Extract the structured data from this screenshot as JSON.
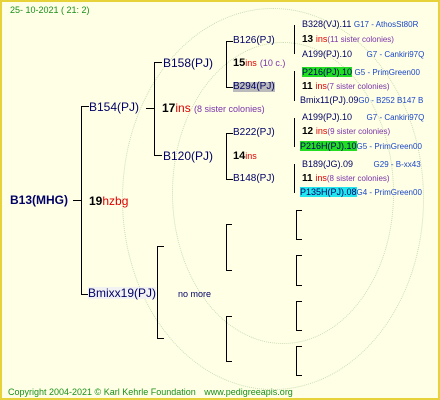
{
  "header": {
    "date": "25- 10-2021 ( 21: 2)"
  },
  "footer": {
    "copyright": "Copyright 2004-2021 © Karl Kehrle Foundation",
    "url": "www.pedigreeapis.org"
  },
  "root": {
    "name": "B13(MHG)",
    "num": "19",
    "ins": "hzbg"
  },
  "gen1": {
    "top": {
      "name": "B154(PJ)",
      "num": "17",
      "ins": "ins",
      "note": "(8 sister colonies)"
    },
    "bottom": {
      "name": "Bmixx19(PJ)",
      "note": "no more"
    }
  },
  "gen2": {
    "a": {
      "name": "B158(PJ)",
      "num": "15",
      "ins": "ins",
      "note": "(10 c.)"
    },
    "b": {
      "name": "B120(PJ)",
      "num": "14",
      "ins": "ins"
    }
  },
  "gen3": {
    "a": {
      "name": "B126(PJ)"
    },
    "b": {
      "name": "B294(PJ)"
    },
    "c": {
      "name": "B222(PJ)"
    },
    "d": {
      "name": "B148(PJ)"
    }
  },
  "gen4": {
    "r1": {
      "name": "B328(VJ).11",
      "extra": "G17 - AthosSt80R"
    },
    "r1i": {
      "num": "13",
      "ins": "ins",
      "note": "(11 sister colonies)"
    },
    "r2": {
      "name": "A199(PJ).10",
      "extra": "G7 - Cankiri97Q"
    },
    "r3": {
      "name": "P216(PJ).10",
      "extra": "G5 - PrimGreen00"
    },
    "r3i": {
      "num": "11",
      "ins": "ins",
      "note": "(7 sister colonies)"
    },
    "r4": {
      "name": "Bmix11(PJ).09",
      "extra": "G0 - B252 B147 B"
    },
    "r5": {
      "name": "A199(PJ).10",
      "extra": "G7 - Cankiri97Q"
    },
    "r5i": {
      "num": "12",
      "ins": "ins",
      "note": "(9 sister colonies)"
    },
    "r6": {
      "name": "P216H(PJ).10",
      "extra": "G5 - PrimGreen00"
    },
    "r7": {
      "name": "B189(JG).09",
      "extra": "G29 - B-xx43"
    },
    "r7i": {
      "num": "11",
      "ins": "ins",
      "note": "(8 sister colonies)"
    },
    "r8": {
      "name": "P135H(PJ).08",
      "extra": "G4 - PrimGreen00"
    }
  }
}
